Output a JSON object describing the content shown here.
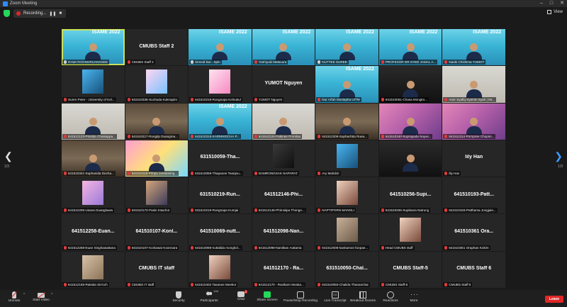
{
  "window": {
    "title": "Zoom Meeting"
  },
  "top": {
    "recording_label": "Recording...",
    "pause_symbol": "❚❚",
    "stop_symbol": "■",
    "view_label": "View"
  },
  "pagination": {
    "left": "1/3",
    "right": "1/3"
  },
  "tiles": [
    {
      "kind": "video-banner",
      "banner": "ISAME 2022",
      "name": "RAWI ROONGRUANGSEE",
      "mic": "on",
      "active": true
    },
    {
      "kind": "name",
      "center": "CMUBS Staff 2",
      "name": "CMUBS Staff 2",
      "mic": "off"
    },
    {
      "kind": "video-banner",
      "banner": "ISAME 2022",
      "name": "Sireedi Bur...Spin",
      "mic": "on"
    },
    {
      "kind": "video-banner",
      "banner": "ISAME 2022",
      "name": "Yoshiyuki Matsuura",
      "mic": "off"
    },
    {
      "kind": "video-banner",
      "banner": "ISAME 2022",
      "name": "NUTTEE SUREE",
      "mic": "on"
    },
    {
      "kind": "video-banner",
      "banner": "ISAME 2022",
      "name": "PROFESOR DR SYED JAMAL A...",
      "mic": "off"
    },
    {
      "kind": "video-banner",
      "banner": "ISAME 2022",
      "name": "Naoki Chishima YUMOT",
      "mic": "off"
    },
    {
      "kind": "avatar",
      "avatar": "hij",
      "name": "Suren Peter - University of Kel...",
      "mic": "off"
    },
    {
      "kind": "avatar",
      "avatar": "cartoon",
      "name": "641510336-Suchada Kuknapim",
      "mic": "off"
    },
    {
      "kind": "avatar",
      "avatar": "flower",
      "name": "641510218-Rungnapa Kelnukul",
      "mic": "off"
    },
    {
      "kind": "name",
      "center": "YUMOT Nguyen",
      "name": "YUMOT Nguyen",
      "mic": "off"
    },
    {
      "kind": "video-banner",
      "banner": "ISAME 2022",
      "name": "Nur Arfah Mustapha UITM",
      "mic": "off"
    },
    {
      "kind": "video-dark",
      "name": "641510061-Chasa Mongko...",
      "mic": "off"
    },
    {
      "kind": "video-light",
      "name": "Amir Syafiq Syamin Syah | Mi...",
      "mic": "off"
    },
    {
      "kind": "video-light",
      "name": "641512123-Pimtida Chaisappa...",
      "mic": "off"
    },
    {
      "kind": "video-room",
      "name": "641510217-Rungtip Duangma...",
      "mic": "off"
    },
    {
      "kind": "video-banner",
      "banner": "ISAME 2022",
      "name": "641510316-KARMHIDCHA P...",
      "mic": "off"
    },
    {
      "kind": "video-light",
      "name": "641510124-Pakinee Promlao",
      "mic": "off"
    },
    {
      "kind": "video-room",
      "name": "641512206-Suphachita Ruea...",
      "mic": "off"
    },
    {
      "kind": "video-pink",
      "name": "641510340-Suprapada Noywi...",
      "mic": "off"
    },
    {
      "kind": "video-pink",
      "name": "641512114-Pornpree Chopim...",
      "mic": "off"
    },
    {
      "kind": "video-room",
      "name": "641510341-Suphanida Decha...",
      "mic": "off"
    },
    {
      "kind": "video-colorful",
      "name": "641510118-Pimpa Jantaasing...",
      "mic": "off"
    },
    {
      "kind": "name",
      "center": "631510059-Tha...",
      "name": "631510059-Thapanee Teanjou...",
      "mic": "off"
    },
    {
      "kind": "avatar",
      "avatar": "dark",
      "name": "DAMRONGSAK NAPARAT",
      "mic": "off"
    },
    {
      "kind": "avatar",
      "avatar": "hij",
      "name": "Ary Mahdzir",
      "mic": "off"
    },
    {
      "kind": "video-dark",
      "name": "",
      "mic": "off"
    },
    {
      "kind": "name",
      "center": "lily Han",
      "name": "lily Han",
      "mic": "off"
    },
    {
      "kind": "avatar",
      "avatar": "pink",
      "name": "641512205-Usana Duangkaew",
      "mic": "off"
    },
    {
      "kind": "avatar",
      "avatar": "person2",
      "name": "641510172-Pasin Intachot",
      "mic": "off"
    },
    {
      "kind": "name",
      "center": "631510219-Run...",
      "name": "631510219-Rungnapa Kumjai",
      "mic": "off"
    },
    {
      "kind": "name",
      "center": "641512146-Phi...",
      "name": "641512146-Phimsiipa Thonge...",
      "mic": "off"
    },
    {
      "kind": "avatar",
      "avatar": "girl",
      "name": "NAPTIPORN MANOLI",
      "mic": "off"
    },
    {
      "kind": "name",
      "center": "641510256-Supi...",
      "name": "641510256-Supitsara Natrung",
      "mic": "off"
    },
    {
      "kind": "name",
      "center": "641510193-Patt...",
      "name": "641510193-Patthama Jongjain...",
      "mic": "off"
    },
    {
      "kind": "name",
      "center": "641512258-Euan...",
      "name": "641512258-Euan Singhawattana",
      "mic": "off"
    },
    {
      "kind": "name",
      "center": "641510107-Konl...",
      "name": "641510107-Konlawat Koonnara",
      "mic": "off"
    },
    {
      "kind": "name",
      "center": "641510069-nutt...",
      "name": "641510069-nuttalida mongkol...",
      "mic": "off"
    },
    {
      "kind": "name",
      "center": "641512098-Nan...",
      "name": "641512098-Nantikan Auttama",
      "mic": "off"
    },
    {
      "kind": "avatar",
      "avatar": "cat",
      "name": "641512008-kankamon funpae...",
      "mic": "off"
    },
    {
      "kind": "avatar",
      "avatar": "girl",
      "name": "Head CMUBS staff",
      "mic": "off"
    },
    {
      "kind": "name",
      "center": "641510361 Ora...",
      "name": "641510361 Oraphan Kokim",
      "mic": "off"
    },
    {
      "kind": "avatar",
      "avatar": "dog",
      "name": "641512155-Raksita Sirroch",
      "mic": "off"
    },
    {
      "kind": "name",
      "center": "CMUBS IT staff",
      "name": "CMUBS IT staff",
      "mic": "off"
    },
    {
      "kind": "avatar",
      "avatar": "girl",
      "name": "641510402 Tasanee Meekor",
      "mic": "off"
    },
    {
      "kind": "name",
      "center": "641512170 - Ra...",
      "name": "641512170 - Ravikarn Mooka...",
      "mic": "off"
    },
    {
      "kind": "name",
      "center": "631510050-Chal...",
      "name": "631510050-Chalida Thananchai",
      "mic": "off"
    },
    {
      "kind": "name",
      "center": "CMUBS Staff-5",
      "name": "CMUBS Staff-5",
      "mic": "off"
    },
    {
      "kind": "name",
      "center": "CMUBS Staff 6",
      "name": "CMUBS Staff 6",
      "mic": "off"
    }
  ],
  "toolbar": {
    "unmute": "Unmute",
    "start_video": "Start Video",
    "security": "Security",
    "participants": "Participants",
    "participants_count": "144",
    "chat": "Chat",
    "chat_badge": "2",
    "share": "Share Screen",
    "record": "Pause/Stop Recording",
    "transcript": "Live Transcript",
    "breakout": "Breakout Rooms",
    "reactions": "Reactions",
    "more": "More",
    "more_symbol": "···",
    "leave": "Leave",
    "cc_symbol": "CC",
    "caret_symbol": "^"
  },
  "colors": {
    "accent_green": "#23d959",
    "active_border": "#c8e25a",
    "danger": "#e02828",
    "next_arrow": "#3a9bff"
  }
}
